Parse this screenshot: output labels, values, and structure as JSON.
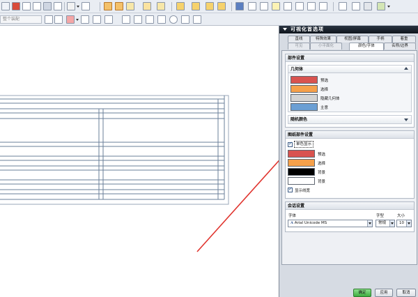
{
  "colors": {
    "preselect": "#d9534f",
    "select": "#f5a04a",
    "hidden_geometry": "#d3d3d3",
    "emphasis": "#6b9fd4",
    "background_black": "#000000",
    "background_white": "#ffffff",
    "annotation_arrow": "#e0332d",
    "table_lines": "#6a7f9a",
    "dialog_bg": "#d6dbe3"
  },
  "toolbar": {
    "filter_placeholder": "整个装配",
    "icons_row1": [
      "new-file-icon",
      "open-icon",
      "save-icon",
      "print-icon",
      "cut-icon",
      "copy-icon",
      "undo-icon",
      "redo-icon",
      "sketch-icon",
      "line-icon",
      "arc-icon",
      "point-icon",
      "measure-icon",
      "layer-icon",
      "view-icon",
      "shade-icon",
      "render-icon",
      "window-icon",
      "help-icon"
    ],
    "icons_row2": [
      "select-filter-icon",
      "snap-icon",
      "grid-icon",
      "point-snap-icon",
      "end-point-icon",
      "mid-point-icon",
      "center-icon",
      "intersect-icon",
      "quadrant-icon",
      "tangent-icon"
    ]
  },
  "dialog": {
    "title": "可视化首选项",
    "tabs_row1": [
      "直线",
      "特殊效果",
      "视图/屏幕",
      "手柄",
      "着重"
    ],
    "tabs_row2": [
      "可见",
      "小平面化",
      "颜色/字体",
      "名称/边界"
    ],
    "active_tab": "颜色/字体",
    "part_settings": {
      "header": "部件设置",
      "geometry": {
        "header": "几何体",
        "items": [
          {
            "label": "预选",
            "color": "#d9534f"
          },
          {
            "label": "选择",
            "color": "#f5a04a"
          },
          {
            "label": "隐藏几何体",
            "color": "#d3d3d3"
          },
          {
            "label": "主意",
            "color": "#6b9fd4"
          }
        ]
      },
      "random_colors_header": "随机颜色"
    },
    "drawing_settings": {
      "header": "图纸部件设置",
      "monochrome_label": "单色显示",
      "monochrome_checked": true,
      "items": [
        {
          "label": "预选",
          "color": "#d9534f"
        },
        {
          "label": "选择",
          "color": "#f5a04a"
        },
        {
          "label": "背景",
          "color": "#000000"
        },
        {
          "label": "背景",
          "color": "#ffffff"
        }
      ],
      "show_width_label": "显示线宽",
      "show_width_checked": true
    },
    "session_settings": {
      "header": "会话设置",
      "font_label": "字体",
      "font_value": "Arial Unicode MS",
      "style_label": "字型",
      "style_value": "常规",
      "size_label": "大小",
      "size_value": "10"
    },
    "buttons": {
      "ok": "确定",
      "apply": "应用",
      "cancel": "取消"
    }
  }
}
